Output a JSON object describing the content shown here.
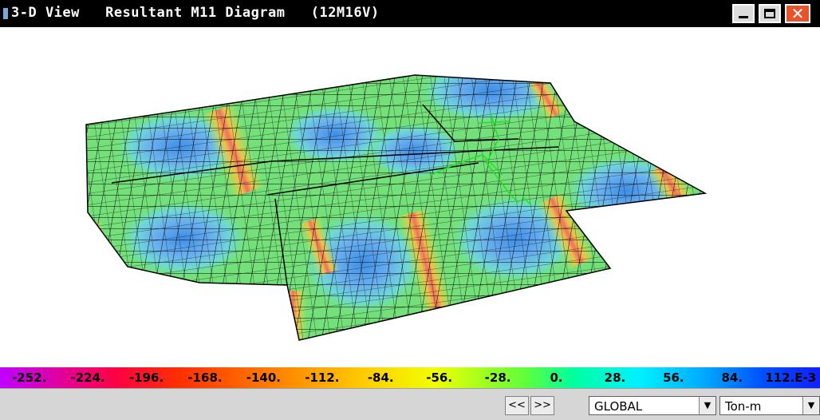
{
  "window": {
    "title": "3-D View   Resultant M11 Diagram   (12M16V)",
    "minimize_label": "",
    "maximize_label": "",
    "close_label": "✕"
  },
  "legend": {
    "labels": [
      "-252.",
      "-224.",
      "-196.",
      "-168.",
      "-140.",
      "-112.",
      "-84.",
      "-56.",
      "-28.",
      "0.",
      "28.",
      "56.",
      "84.",
      "112.E-3"
    ],
    "colors": [
      "#c000ff",
      "#ff0044",
      "#ff3000",
      "#ff6000",
      "#ff8a00",
      "#ffb000",
      "#ffd000",
      "#f0ff00",
      "#60ff3a",
      "#00ffa0",
      "#00f0ff",
      "#00a8ff",
      "#0050ff",
      "#1020ff"
    ]
  },
  "statusbar": {
    "prev_label": "<<",
    "next_label": ">>",
    "coord_system": "GLOBAL",
    "units": "Ton-m"
  },
  "icons": {
    "dropdown": "chevron-down-icon",
    "app": "app-icon"
  }
}
